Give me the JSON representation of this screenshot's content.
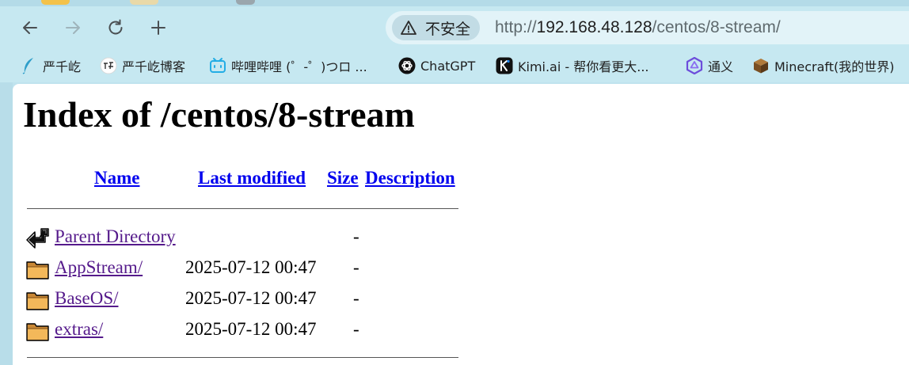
{
  "browser": {
    "security_label": "不安全",
    "url_scheme": "http://",
    "url_host": "192.168.48.128",
    "url_path": "/centos/8-stream/"
  },
  "bookmarks": [
    {
      "label": "严千屹",
      "icon": "feather-icon"
    },
    {
      "label": "严千屹博客",
      "icon": "blog-logo-icon"
    },
    {
      "label": "哔哩哔哩 (゜-゜)つロ ...",
      "icon": "bilibili-icon"
    },
    {
      "label": "ChatGPT",
      "icon": "chatgpt-icon"
    },
    {
      "label": "Kimi.ai - 帮你看更大...",
      "icon": "kimi-icon"
    },
    {
      "label": "通义",
      "icon": "tongyi-icon"
    },
    {
      "label": "Minecraft(我的世界)",
      "icon": "minecraft-block-icon"
    }
  ],
  "page": {
    "title": "Index of /centos/8-stream",
    "columns": {
      "name": "Name",
      "last_modified": "Last modified",
      "size": "Size",
      "description": "Description"
    },
    "entries": [
      {
        "name": "Parent Directory",
        "modified": "",
        "size": "-",
        "icon": "back-arrow-icon"
      },
      {
        "name": "AppStream/",
        "modified": "2025-07-12 00:47",
        "size": "-",
        "icon": "folder-icon"
      },
      {
        "name": "BaseOS/",
        "modified": "2025-07-12 00:47",
        "size": "-",
        "icon": "folder-icon"
      },
      {
        "name": "extras/",
        "modified": "2025-07-12 00:47",
        "size": "-",
        "icon": "folder-icon"
      }
    ]
  },
  "colors": {
    "link": "#0000ee",
    "visited_link": "#551a8b",
    "chrome": "#c6e8f1"
  }
}
